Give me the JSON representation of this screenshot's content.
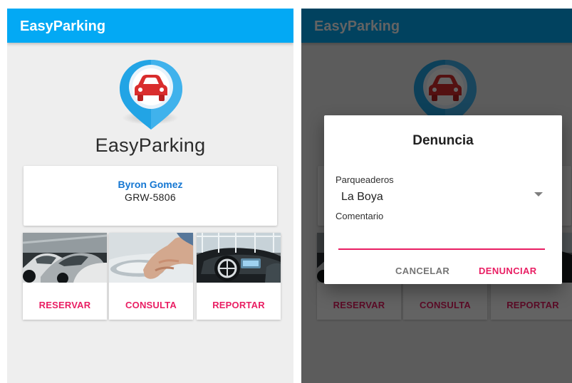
{
  "app": {
    "title": "EasyParking",
    "brand_name": "EasyParking"
  },
  "user": {
    "name": "Byron Gomez",
    "plate": "GRW-5806"
  },
  "actions": [
    {
      "label": "RESERVAR",
      "image": "parked-cars-photo"
    },
    {
      "label": "CONSULTA",
      "image": "car-door-hand-photo"
    },
    {
      "label": "REPORTAR",
      "image": "car-interior-photo"
    }
  ],
  "dialog": {
    "title": "Denuncia",
    "parking_label": "Parqueaderos",
    "selected_parking": "La Boya",
    "comment_label": "Comentario",
    "comment_value": "",
    "cancel_label": "CANCELAR",
    "submit_label": "DENUNCIAR"
  },
  "colors": {
    "app_bar": "#03a9f4",
    "accent": "#e91e63",
    "user_name": "#1577d2",
    "background": "#eeeeee"
  },
  "icons": {
    "logo": "car-location-pin-icon",
    "dropdown": "dropdown-arrow-icon"
  }
}
